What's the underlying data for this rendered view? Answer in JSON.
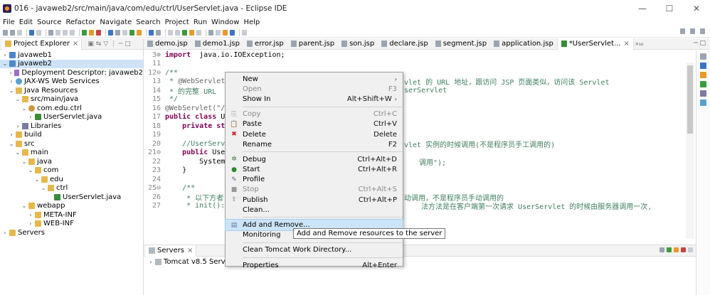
{
  "window": {
    "title": "016 - javaweb2/src/main/java/com/edu/ctrl/UserServlet.java - Eclipse IDE",
    "minimize": "—",
    "maximize": "☐",
    "close": "✕"
  },
  "menubar": [
    "File",
    "Edit",
    "Source",
    "Refactor",
    "Navigate",
    "Search",
    "Project",
    "Run",
    "Window",
    "Help"
  ],
  "project_explorer": {
    "tab_label": "Project Explorer",
    "tree": [
      {
        "label": "javaweb1",
        "depth": 0,
        "twisty": "›",
        "icon": "proj"
      },
      {
        "label": "javaweb2",
        "depth": 0,
        "twisty": "⌄",
        "icon": "proj",
        "selected": true
      },
      {
        "label": "Deployment Descriptor: javaweb2",
        "depth": 1,
        "twisty": "›",
        "icon": "desc"
      },
      {
        "label": "JAX-WS Web Services",
        "depth": 1,
        "twisty": "›",
        "icon": "ws"
      },
      {
        "label": "Java Resources",
        "depth": 1,
        "twisty": "⌄",
        "icon": "folder"
      },
      {
        "label": "src/main/java",
        "depth": 2,
        "twisty": "⌄",
        "icon": "folder"
      },
      {
        "label": "com.edu.ctrl",
        "depth": 3,
        "twisty": "⌄",
        "icon": "pkg"
      },
      {
        "label": "UserServlet.java",
        "depth": 4,
        "twisty": "›",
        "icon": "java"
      },
      {
        "label": "Libraries",
        "depth": 2,
        "twisty": "›",
        "icon": "lib"
      },
      {
        "label": "build",
        "depth": 1,
        "twisty": "›",
        "icon": "folder"
      },
      {
        "label": "src",
        "depth": 1,
        "twisty": "⌄",
        "icon": "folder"
      },
      {
        "label": "main",
        "depth": 2,
        "twisty": "⌄",
        "icon": "folder"
      },
      {
        "label": "java",
        "depth": 3,
        "twisty": "⌄",
        "icon": "folder"
      },
      {
        "label": "com",
        "depth": 4,
        "twisty": "⌄",
        "icon": "folder"
      },
      {
        "label": "edu",
        "depth": 5,
        "twisty": "⌄",
        "icon": "folder"
      },
      {
        "label": "ctrl",
        "depth": 6,
        "twisty": "⌄",
        "icon": "folder"
      },
      {
        "label": "UserServlet.java",
        "depth": 7,
        "twisty": "",
        "icon": "java"
      },
      {
        "label": "webapp",
        "depth": 3,
        "twisty": "⌄",
        "icon": "folder"
      },
      {
        "label": "META-INF",
        "depth": 4,
        "twisty": "›",
        "icon": "folder"
      },
      {
        "label": "WEB-INF",
        "depth": 4,
        "twisty": "›",
        "icon": "folder"
      },
      {
        "label": "Servers",
        "depth": 0,
        "twisty": "›",
        "icon": "folder"
      }
    ]
  },
  "editor_tabs": [
    {
      "label": "demo.jsp"
    },
    {
      "label": "demo1.jsp"
    },
    {
      "label": "error.jsp"
    },
    {
      "label": "parent.jsp"
    },
    {
      "label": "son.jsp"
    },
    {
      "label": "declare.jsp"
    },
    {
      "label": "segment.jsp"
    },
    {
      "label": "application.jsp"
    },
    {
      "label": "*UserServlet...",
      "active": true
    }
  ],
  "editor_overflow": "»₁₆",
  "code_lines": [
    {
      "n": "3⊕",
      "parts": [
        [
          "kw",
          "import"
        ],
        [
          "",
          "  java.io.IOException;"
        ]
      ]
    },
    {
      "n": "11",
      "parts": []
    },
    {
      "n": "12⊖",
      "parts": [
        [
          "cm",
          "/**"
        ]
      ]
    },
    {
      "n": "13",
      "parts": [
        [
          "cm",
          " * "
        ],
        [
          "ann",
          "@WebServlet"
        ],
        [
          "cm",
          " "
        ]
      ]
    },
    {
      "n": "14",
      "parts": [
        [
          "cm",
          " * 的完整 URL"
        ]
      ]
    },
    {
      "n": "15",
      "parts": [
        [
          "cm",
          " */"
        ]
      ]
    },
    {
      "n": "16",
      "parts": [
        [
          "ann",
          "@WebServlet(\"/"
        ]
      ]
    },
    {
      "n": "17",
      "parts": [
        [
          "kw",
          "public class"
        ],
        [
          "",
          " U"
        ]
      ]
    },
    {
      "n": "18",
      "parts": [
        [
          "",
          "    "
        ],
        [
          "kw",
          "private st"
        ]
      ]
    },
    {
      "n": "19",
      "parts": []
    },
    {
      "n": "20",
      "parts": [
        [
          "cm",
          "    //UserServ"
        ]
      ]
    },
    {
      "n": "21⊖",
      "parts": [
        [
          "",
          "    "
        ],
        [
          "kw",
          "public"
        ],
        [
          "",
          " Use"
        ]
      ]
    },
    {
      "n": "22",
      "parts": [
        [
          "",
          "        System."
        ]
      ]
    },
    {
      "n": "23",
      "parts": [
        [
          "",
          "    }"
        ]
      ]
    },
    {
      "n": "24",
      "parts": []
    },
    {
      "n": "25⊖",
      "parts": [
        [
          "cm",
          "    /**"
        ]
      ]
    },
    {
      "n": "26",
      "parts": [
        [
          "cm",
          "     * 以下方者"
        ]
      ]
    },
    {
      "n": "27",
      "parts": [
        [
          "cm",
          "     * init():"
        ]
      ]
    }
  ],
  "code_right": {
    "line13": "vlet 的 URL 地址，跟访问 JSP 页面类似，访问该 Servlet",
    "line14": "serServlet",
    "line20": "vlet 实例的时候调用(不是程序员手工调用的)",
    "line22": "调用\");",
    "line26": "动调用，不是程序员手动调用的",
    "line27": "法方法是在客户端第一次请求 UserServlet 的时候由服务器调用一次,"
  },
  "context_menu": {
    "items": [
      {
        "type": "item",
        "label": "New",
        "accel": "",
        "submenu": true,
        "icon": ""
      },
      {
        "type": "item",
        "label": "Open",
        "accel": "F3",
        "disabled": true,
        "icon": ""
      },
      {
        "type": "item",
        "label": "Show In",
        "accel": "Alt+Shift+W",
        "submenu": true,
        "icon": ""
      },
      {
        "type": "sep"
      },
      {
        "type": "item",
        "label": "Copy",
        "accel": "Ctrl+C",
        "disabled": true,
        "icon": "copy"
      },
      {
        "type": "item",
        "label": "Paste",
        "accel": "Ctrl+V",
        "icon": "paste"
      },
      {
        "type": "item",
        "label": "Delete",
        "accel": "Delete",
        "icon": "delete"
      },
      {
        "type": "item",
        "label": "Rename",
        "accel": "F2",
        "icon": ""
      },
      {
        "type": "sep"
      },
      {
        "type": "item",
        "label": "Debug",
        "accel": "Ctrl+Alt+D",
        "icon": "debug"
      },
      {
        "type": "item",
        "label": "Start",
        "accel": "Ctrl+Alt+R",
        "icon": "start"
      },
      {
        "type": "item",
        "label": "Profile",
        "accel": "",
        "icon": "profile"
      },
      {
        "type": "item",
        "label": "Stop",
        "accel": "Ctrl+Alt+S",
        "disabled": true,
        "icon": "stop"
      },
      {
        "type": "item",
        "label": "Publish",
        "accel": "Ctrl+Alt+P",
        "icon": "publish"
      },
      {
        "type": "item",
        "label": "Clean...",
        "accel": "",
        "icon": ""
      },
      {
        "type": "sep"
      },
      {
        "type": "item",
        "label": "Add and Remove...",
        "accel": "",
        "hover": true,
        "icon": "addremove"
      },
      {
        "type": "item",
        "label": "Monitoring",
        "accel": "",
        "submenu": true,
        "icon": ""
      },
      {
        "type": "sep"
      },
      {
        "type": "item",
        "label": "Clean Tomcat Work Directory...",
        "accel": "",
        "icon": ""
      },
      {
        "type": "sep"
      },
      {
        "type": "item",
        "label": "Properties",
        "accel": "Alt+Enter",
        "icon": ""
      }
    ]
  },
  "tooltip": "Add and Remove resources to the server",
  "servers_view": {
    "tab_label": "Servers",
    "row": "Tomcat v8.5 Server at localhost  [Stopped]"
  },
  "colors": {
    "selection": "#cfe3f7",
    "menu_hover": "#cce4f7",
    "keyword": "#7f0055",
    "comment": "#3f7f5f"
  }
}
